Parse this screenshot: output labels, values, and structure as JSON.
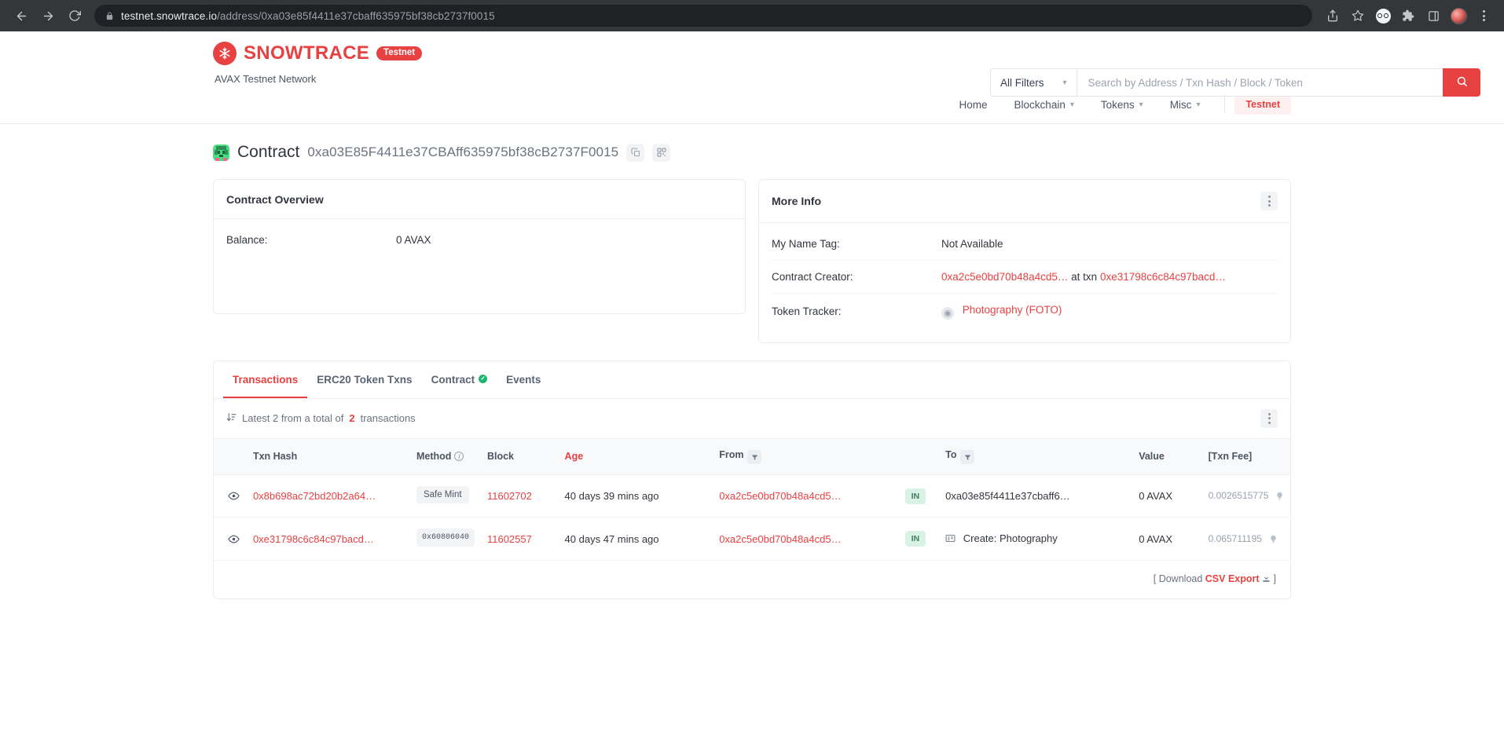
{
  "browser": {
    "url_domain": "testnet.snowtrace.io",
    "url_path": "/address/0xa03e85f4411e37cbaff635975bf38cb2737f0015",
    "back_icon": "back-arrow-icon",
    "forward_icon": "forward-arrow-icon",
    "reload_icon": "reload-icon",
    "lock_icon": "lock-icon",
    "share_icon": "share-icon",
    "bookmark_icon": "bookmark-star-icon",
    "extension_icon": "extension-icon",
    "puzzle_icon": "puzzle-piece-icon",
    "sidepanel_icon": "side-panel-icon",
    "profile_icon": "profile-avatar-icon",
    "menu_icon": "browser-menu-icon"
  },
  "header": {
    "brand_name": "SNOWTRACE",
    "brand_badge": "Testnet",
    "network_label": "AVAX Testnet Network",
    "logo_icon": "snowflake-logo-icon",
    "search": {
      "filter_label": "All Filters",
      "placeholder": "Search by Address / Txn Hash / Block / Token",
      "value": "",
      "search_icon": "search-icon",
      "chevron_icon": "chevron-down-icon"
    },
    "nav": [
      {
        "label": "Home",
        "has_chevron": false
      },
      {
        "label": "Blockchain",
        "has_chevron": true
      },
      {
        "label": "Tokens",
        "has_chevron": true
      },
      {
        "label": "Misc",
        "has_chevron": true
      }
    ],
    "network_badge": "Testnet"
  },
  "page": {
    "title": "Contract",
    "address": "0xa03E85F4411e37CBAff635975bf38cB2737F0015",
    "identicon": "contract-identicon",
    "copy_icon": "copy-icon",
    "qr_icon": "qr-code-icon"
  },
  "overview": {
    "heading": "Contract Overview",
    "rows": [
      {
        "label": "Balance:",
        "value": "0 AVAX"
      }
    ]
  },
  "more_info": {
    "heading": "More Info",
    "kebab_icon": "more-options-icon",
    "name_tag_label": "My Name Tag:",
    "name_tag_value": "Not Available",
    "creator_label": "Contract Creator:",
    "creator_address": "0xa2c5e0bd70b48a4cd5…",
    "creator_at_txn": "at txn",
    "creator_txn": "0xe31798c6c84c97bacd…",
    "token_tracker_label": "Token Tracker:",
    "token_tracker_value": "Photography (FOTO)",
    "token_icon": "token-logo-icon"
  },
  "tabs": [
    {
      "label": "Transactions",
      "active": true,
      "verified": false
    },
    {
      "label": "ERC20 Token Txns",
      "active": false,
      "verified": false
    },
    {
      "label": "Contract",
      "active": false,
      "verified": true
    },
    {
      "label": "Events",
      "active": false,
      "verified": false
    }
  ],
  "summary": {
    "sort_icon": "sort-descending-icon",
    "prefix": "Latest 2 from a total of",
    "count": "2",
    "suffix": "transactions",
    "kebab_icon": "more-options-icon"
  },
  "table": {
    "columns": [
      "Txn Hash",
      "Method",
      "Block",
      "Age",
      "From",
      "",
      "To",
      "Value",
      "[Txn Fee]"
    ],
    "method_info_icon": "info-icon",
    "from_filter_icon": "filter-icon",
    "to_filter_icon": "filter-icon",
    "rows": [
      {
        "eye_icon": "eye-icon",
        "txn_hash": "0x8b698ac72bd20b2a64…",
        "method": "Safe Mint",
        "method_is_hex": false,
        "block": "11602702",
        "age": "40 days 39 mins ago",
        "from": "0xa2c5e0bd70b48a4cd5…",
        "direction": "IN",
        "to": "0xa03e85f4411e37cbaff6…",
        "to_is_create": false,
        "value": "0 AVAX",
        "fee": "0.0026515775",
        "fee_icon": "gas-bulb-icon"
      },
      {
        "eye_icon": "eye-icon",
        "txn_hash": "0xe31798c6c84c97bacd…",
        "method": "0x60806040",
        "method_is_hex": true,
        "block": "11602557",
        "age": "40 days 47 mins ago",
        "from": "0xa2c5e0bd70b48a4cd5…",
        "direction": "IN",
        "to": "Create: Photography",
        "to_is_create": true,
        "to_icon": "contract-create-icon",
        "value": "0 AVAX",
        "fee": "0.065711195",
        "fee_icon": "gas-bulb-icon"
      }
    ]
  },
  "footer": {
    "bracket_open": "[",
    "download_label": "Download",
    "csv_label": "CSV Export",
    "download_icon": "download-icon",
    "bracket_close": "]"
  },
  "colors": {
    "accent": "#e84142",
    "text": "#31353d",
    "muted": "#6b7280",
    "verified_green": "#21b66f",
    "in_badge_bg": "#d9f2e6"
  }
}
